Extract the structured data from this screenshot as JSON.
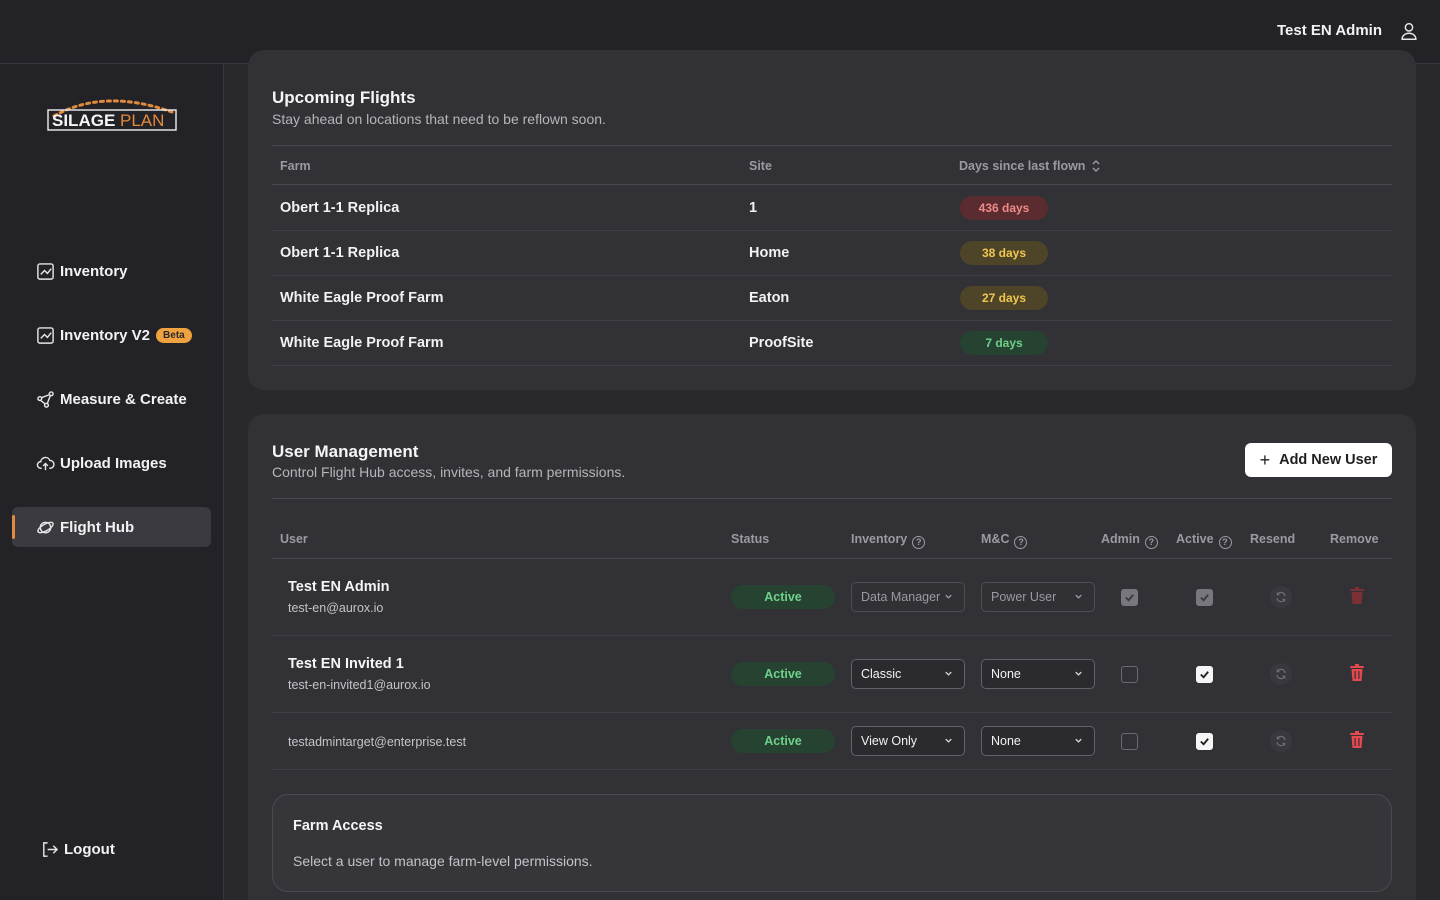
{
  "header": {
    "user_name": "Test EN Admin",
    "user_icon": "user-icon"
  },
  "sidebar": {
    "logo_text": "SILAGEPLAN",
    "items": [
      {
        "label": "Inventory",
        "icon": "chart-icon"
      },
      {
        "label": "Inventory V2",
        "icon": "chart-icon",
        "badge": "Beta"
      },
      {
        "label": "Measure & Create",
        "icon": "measure-icon"
      },
      {
        "label": "Upload Images",
        "icon": "cloud-upload-icon"
      },
      {
        "label": "Flight Hub",
        "icon": "planet-icon",
        "selected": true
      }
    ],
    "logout_label": "Logout"
  },
  "flights": {
    "title": "Upcoming Flights",
    "subtitle": "Stay ahead on locations that need to be reflown soon.",
    "columns": {
      "farm": "Farm",
      "site": "Site",
      "days": "Days since last flown"
    },
    "rows": [
      {
        "farm": "Obert 1-1 Replica",
        "site": "1",
        "days": "436 days",
        "severity": "red"
      },
      {
        "farm": "Obert 1-1 Replica",
        "site": "Home",
        "days": "38 days",
        "severity": "amber"
      },
      {
        "farm": "White Eagle Proof Farm",
        "site": "Eaton",
        "days": "27 days",
        "severity": "amber"
      },
      {
        "farm": "White Eagle Proof Farm",
        "site": "ProofSite",
        "days": "7 days",
        "severity": "green"
      }
    ]
  },
  "users": {
    "title": "User Management",
    "subtitle": "Control Flight Hub access, invites, and farm permissions.",
    "add_label": "Add New User",
    "columns": {
      "user": "User",
      "status": "Status",
      "inventory": "Inventory",
      "mc": "M&C",
      "admin": "Admin",
      "active": "Active",
      "resend": "Resend",
      "remove": "Remove"
    },
    "rows": [
      {
        "name": "Test EN Admin",
        "email": "test-en@aurox.io",
        "status": "Active",
        "inventory": "Data Manager",
        "mc": "Power User",
        "admin": true,
        "active": true,
        "locked": true
      },
      {
        "name": "Test EN Invited 1",
        "email": "test-en-invited1@aurox.io",
        "status": "Active",
        "inventory": "Classic",
        "mc": "None",
        "admin": false,
        "active": true,
        "locked": false
      },
      {
        "name": "",
        "email": "testadmintarget@enterprise.test",
        "status": "Active",
        "inventory": "View Only",
        "mc": "None",
        "admin": false,
        "active": true,
        "locked": false
      }
    ]
  },
  "farm_access": {
    "title": "Farm Access",
    "subtitle": "Select a user to manage farm-level permissions."
  },
  "colors": {
    "accent": "#e08a3c",
    "danger": "#e5484d",
    "success": "#6fd08a",
    "warning": "#f0c850"
  }
}
